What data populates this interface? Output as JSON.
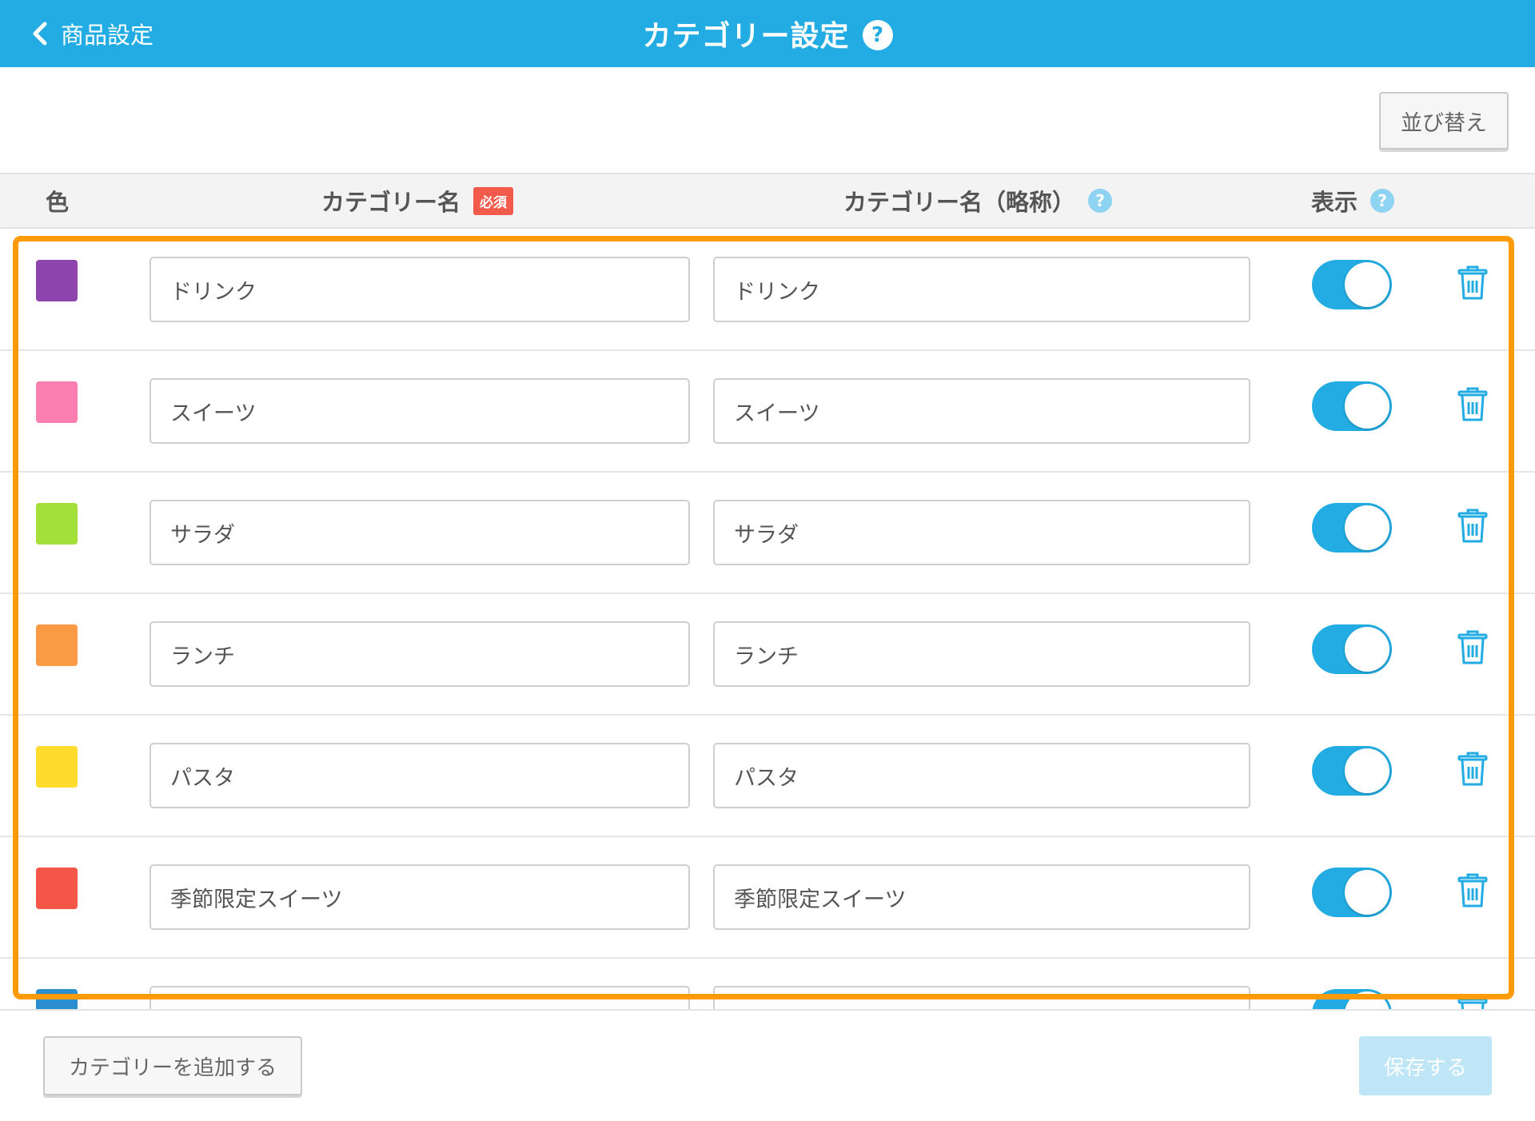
{
  "header": {
    "back_label": "商品設定",
    "title": "カテゴリー設定",
    "help_glyph": "?"
  },
  "toolbar": {
    "sort_label": "並び替え"
  },
  "table": {
    "col_color": "色",
    "col_name": "カテゴリー名",
    "required_badge": "必須",
    "col_short_name": "カテゴリー名（略称）",
    "col_display": "表示",
    "help_glyph": "?"
  },
  "rows": [
    {
      "color": "#8e44ad",
      "name": "ドリンク",
      "short_name": "ドリンク",
      "display": true
    },
    {
      "color": "#fc7fb1",
      "name": "スイーツ",
      "short_name": "スイーツ",
      "display": true
    },
    {
      "color": "#a3e03a",
      "name": "サラダ",
      "short_name": "サラダ",
      "display": true
    },
    {
      "color": "#fb9a45",
      "name": "ランチ",
      "short_name": "ランチ",
      "display": true
    },
    {
      "color": "#fddc2e",
      "name": "パスタ",
      "short_name": "パスタ",
      "display": true
    },
    {
      "color": "#f45647",
      "name": "季節限定スイーツ",
      "short_name": "季節限定スイーツ",
      "display": true
    },
    {
      "color": "#2b8ecf",
      "name": "",
      "short_name": "",
      "display": true
    }
  ],
  "footer": {
    "add_label": "カテゴリーを追加する",
    "save_label": "保存する"
  },
  "colors": {
    "accent": "#22ace3",
    "highlight": "#ff9a08",
    "required": "#f25b4c"
  }
}
